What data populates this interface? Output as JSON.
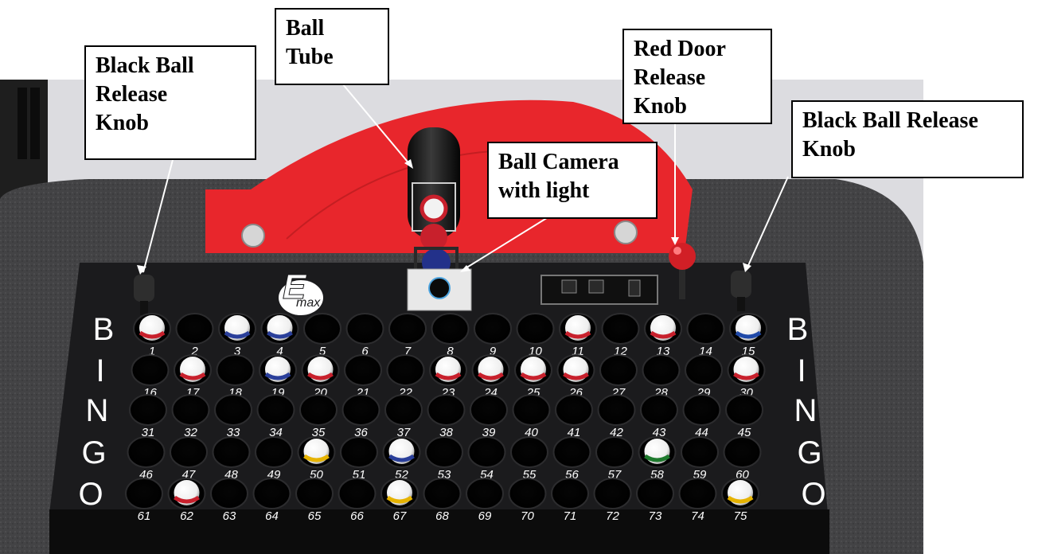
{
  "callouts": {
    "left_knob": [
      "Black Ball",
      "Release",
      "Knob"
    ],
    "ball_tube": [
      "Ball",
      "Tube"
    ],
    "ball_camera": [
      "Ball Camera",
      "with light"
    ],
    "red_door": [
      "Red Door",
      "Release",
      "Knob"
    ],
    "right_knob": [
      "Black Ball Release",
      "Knob"
    ]
  },
  "board": {
    "letters": [
      "B",
      "I",
      "N",
      "G",
      "O"
    ],
    "numbers": [
      "1",
      "2",
      "3",
      "4",
      "5",
      "6",
      "7",
      "8",
      "9",
      "10",
      "11",
      "12",
      "13",
      "14",
      "15",
      "16",
      "17",
      "18",
      "19",
      "20",
      "21",
      "22",
      "23",
      "24",
      "25",
      "26",
      "27",
      "28",
      "29",
      "30",
      "31",
      "32",
      "33",
      "34",
      "35",
      "36",
      "37",
      "38",
      "39",
      "40",
      "41",
      "42",
      "43",
      "44",
      "45",
      "46",
      "47",
      "48",
      "49",
      "50",
      "51",
      "52",
      "53",
      "54",
      "55",
      "56",
      "57",
      "58",
      "59",
      "60",
      "61",
      "62",
      "63",
      "64",
      "65",
      "66",
      "67",
      "68",
      "69",
      "70",
      "71",
      "72",
      "73",
      "74",
      "75"
    ],
    "balls_in_holes": [
      1,
      3,
      4,
      11,
      13,
      15,
      17,
      19,
      20,
      23,
      24,
      25,
      26,
      30,
      50,
      52,
      58,
      62,
      67,
      75
    ],
    "ball_stripe_colors": {
      "1": "#c8202c",
      "3": "#2a3f9a",
      "4": "#2a3f9a",
      "11": "#c8202c",
      "13": "#c8202c",
      "15": "#1f49a8",
      "17": "#c8202c",
      "19": "#2a3f9a",
      "20": "#c8202c",
      "23": "#c8202c",
      "24": "#c8202c",
      "25": "#c8202c",
      "26": "#c8202c",
      "30": "#c8202c",
      "50": "#e6b300",
      "52": "#2a3f9a",
      "58": "#1e7a2d",
      "62": "#c8202c",
      "67": "#e6b300",
      "75": "#e6b300"
    },
    "logo_text": "E max"
  },
  "colors": {
    "table": "#3d3d3f",
    "panel": "#1e1e20",
    "red_top": "#e8262c",
    "backdrop": "#d8d8dc"
  }
}
